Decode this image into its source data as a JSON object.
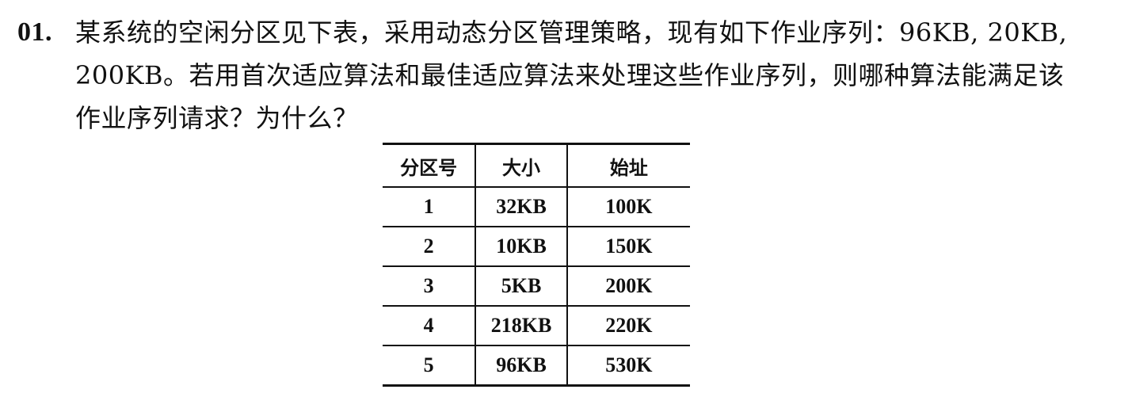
{
  "question": {
    "number": "01.",
    "lines": [
      "某系统的空闲分区见下表，采用动态分区管理策略，现有如下作业序列：96KB, 20KB,",
      "200KB。若用首次适应算法和最佳适应算法来处理这些作业序列，则哪种算法能满足该",
      "作业序列请求？为什么？"
    ]
  },
  "table": {
    "headers": [
      "分区号",
      "大小",
      "始址"
    ],
    "rows": [
      [
        "1",
        "32KB",
        "100K"
      ],
      [
        "2",
        "10KB",
        "150K"
      ],
      [
        "3",
        "5KB",
        "200K"
      ],
      [
        "4",
        "218KB",
        "220K"
      ],
      [
        "5",
        "96KB",
        "530K"
      ]
    ]
  }
}
